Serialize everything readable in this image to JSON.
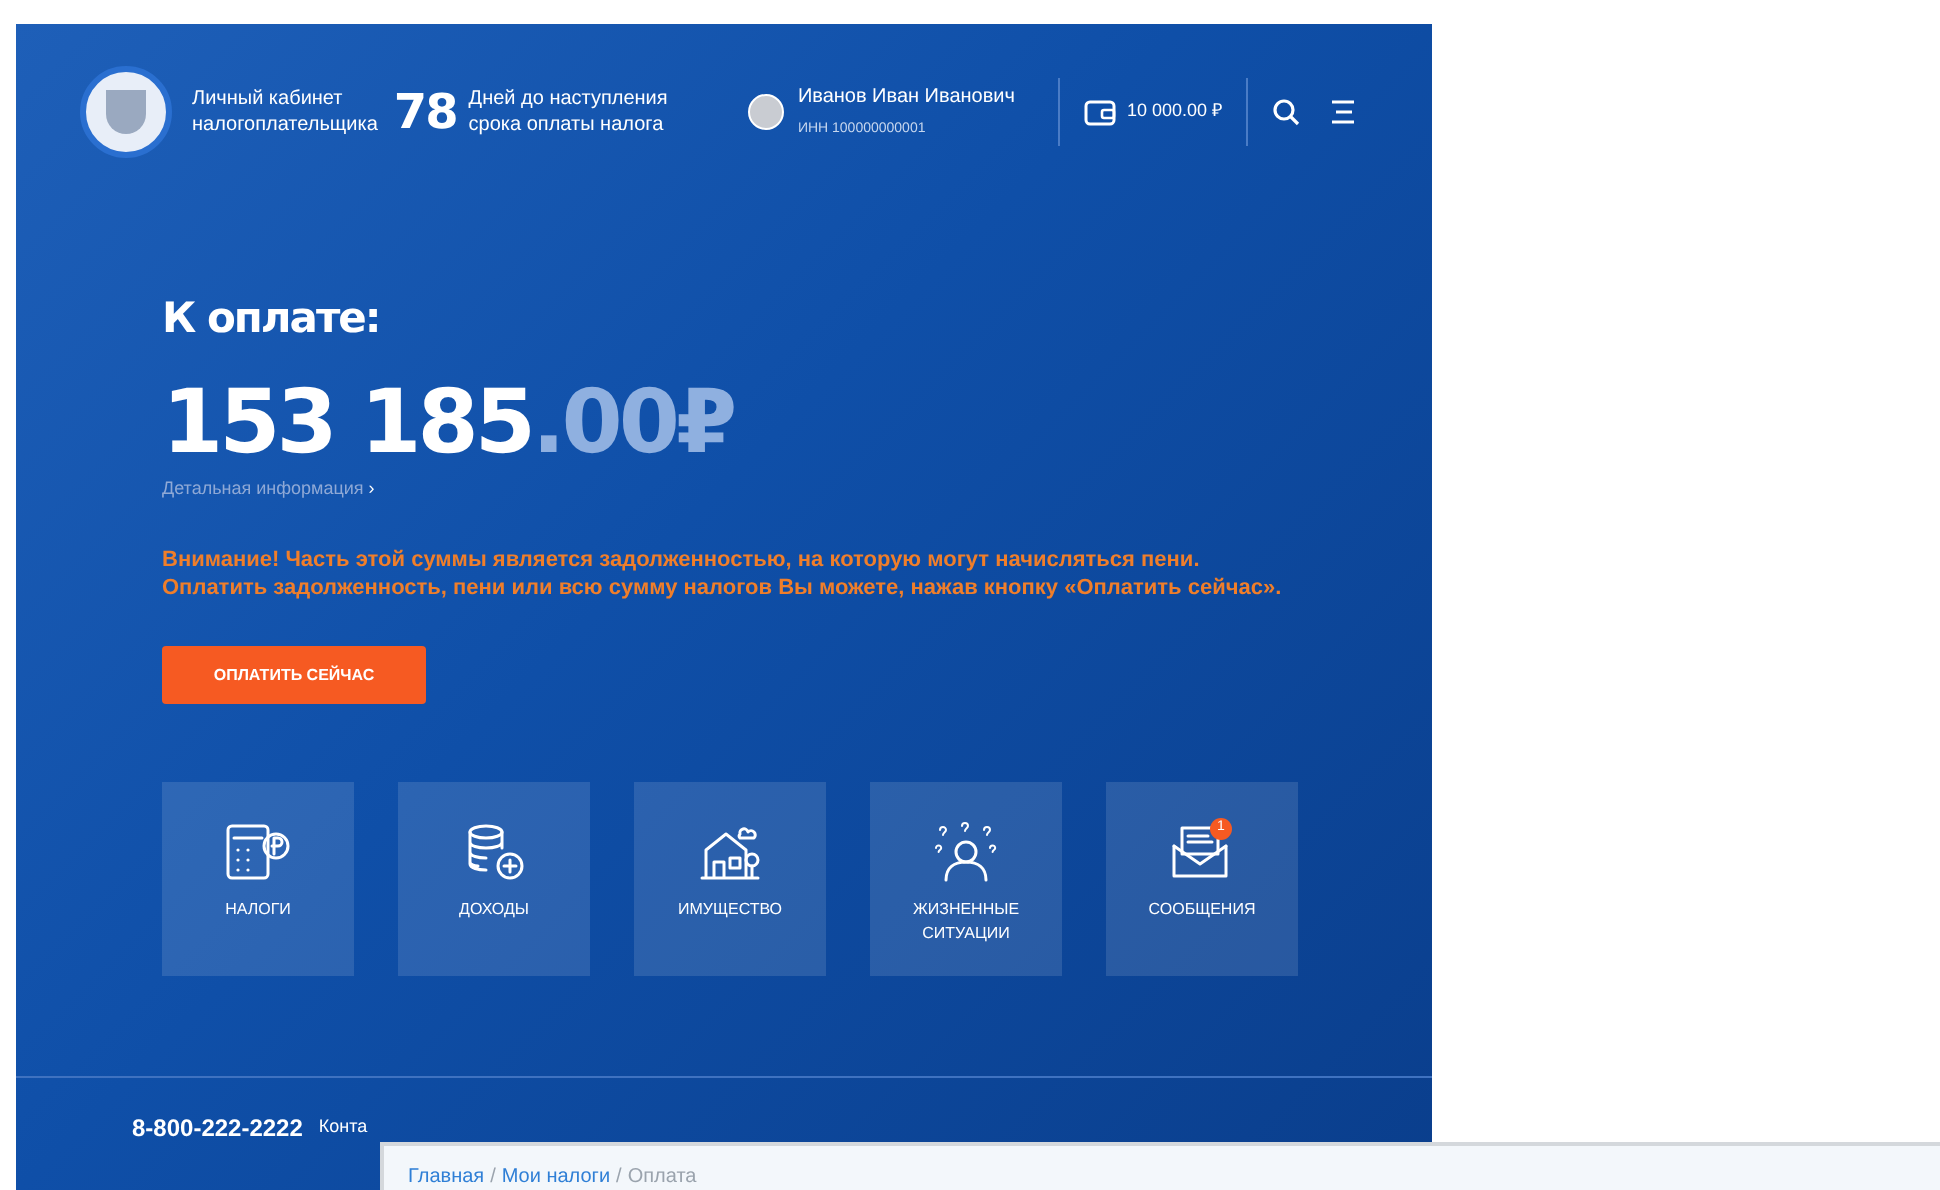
{
  "header": {
    "cabinet_title": "Личный кабинет\nналогоплательщика",
    "days_count": "78",
    "days_text": "Дней до наступления\nсрока оплаты налога",
    "user_name": "Иванов Иван Иванович",
    "inn": "ИНН 100000000001",
    "balance": "10 000.00 ₽"
  },
  "payment": {
    "heading": "К оплате:",
    "amount_main": "153 185",
    "amount_fraction": ".00₽",
    "details_link": "Детальная информация",
    "chevron": "›",
    "warning": "Внимание! Часть этой суммы является задолженностью, на которую могут начисляться пени. Оплатить задолженность, пени или всю сумму налогов Вы можете, нажав кнопку «Оплатить сейчас».",
    "pay_button": "ОПЛАТИТЬ СЕЙЧАС"
  },
  "tiles": [
    {
      "kind": "taxes",
      "label": "НАЛОГИ"
    },
    {
      "kind": "income",
      "label": "ДОХОДЫ"
    },
    {
      "kind": "property",
      "label": "ИМУЩЕСТВО"
    },
    {
      "kind": "life",
      "label": "ЖИЗНЕННЫЕ\nСИТУАЦИИ"
    },
    {
      "kind": "messages",
      "label": "СООБЩЕНИЯ",
      "badge": "1"
    }
  ],
  "footer": {
    "phone": "8-800-222-2222",
    "contacts": "Конта"
  },
  "breadcrumbs": [
    {
      "label": "Главная",
      "selected": false
    },
    {
      "label": "Мои налоги",
      "selected": false
    },
    {
      "label": "Оплата",
      "selected": true
    }
  ],
  "breadcrumb_separator": "/"
}
